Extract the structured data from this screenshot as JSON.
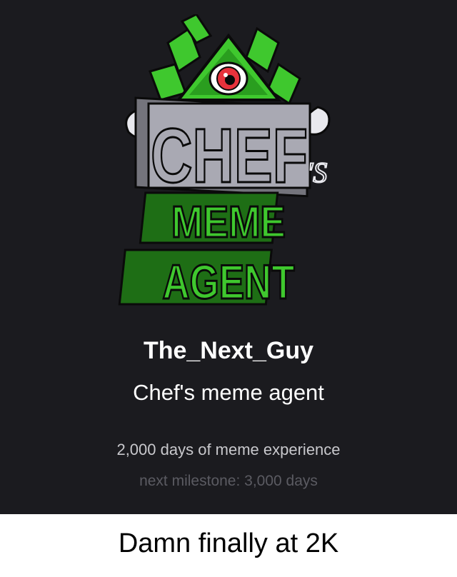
{
  "profile": {
    "username": "The_Next_Guy",
    "title": "Chef's meme agent",
    "experience": "2,000 days of meme experience",
    "milestone": "next milestone: 3,000 days"
  },
  "logo": {
    "line1": "CHEF",
    "line1_suffix": "'S",
    "line2": "MEME",
    "line3": "AGENT",
    "icon": "eye-of-providence-icon"
  },
  "caption": "Damn finally at 2K",
  "colors": {
    "background": "#1b1b1f",
    "accent_green": "#3fc82e",
    "logo_gray": "#a9a9b3",
    "eye_red": "#e8323c"
  }
}
